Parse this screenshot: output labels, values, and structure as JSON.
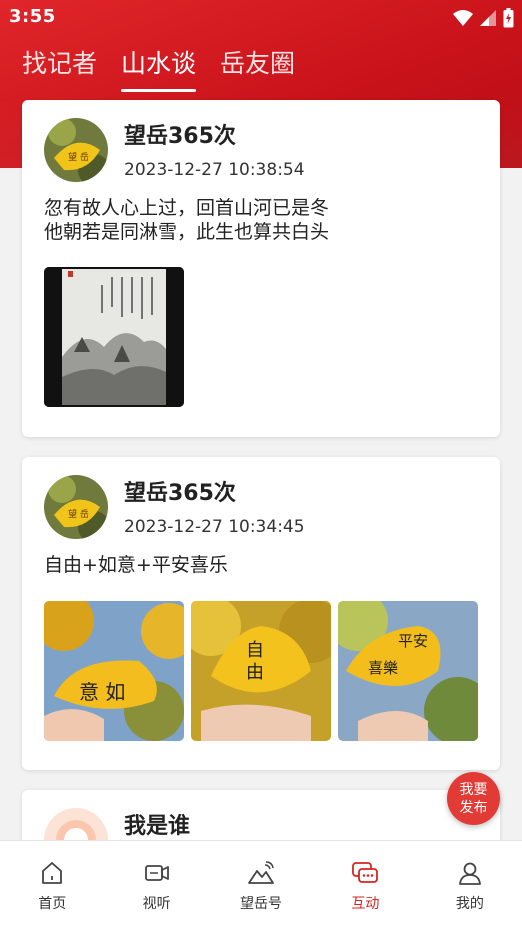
{
  "status_bar": {
    "time": "3:55"
  },
  "tabs": [
    {
      "label": "找记者",
      "active": false
    },
    {
      "label": "山水谈",
      "active": true
    },
    {
      "label": "岳友圈",
      "active": false
    }
  ],
  "posts": [
    {
      "user": "望岳365次",
      "time": "2023-12-27 10:38:54",
      "text": "忽有故人心上过，回首山河已是冬\n他朝若是同淋雪，此生也算共白头",
      "images": [
        "snow-landscape-calligraphy"
      ]
    },
    {
      "user": "望岳365次",
      "time": "2023-12-27 10:34:45",
      "text": "自由+如意+平安喜乐",
      "images": [
        "ginkgo-leaf-ruyi",
        "ginkgo-leaf-ziyou",
        "ginkgo-leaf-pingan-xile"
      ]
    },
    {
      "user": "我是谁"
    }
  ],
  "fab": {
    "line1": "我要",
    "line2": "发布"
  },
  "bottom_nav": [
    {
      "label": "首页",
      "icon": "home-icon",
      "active": false
    },
    {
      "label": "视听",
      "icon": "video-icon",
      "active": false
    },
    {
      "label": "望岳号",
      "icon": "mountain-icon",
      "active": false
    },
    {
      "label": "互动",
      "icon": "chat-icon",
      "active": true
    },
    {
      "label": "我的",
      "icon": "user-icon",
      "active": false
    }
  ],
  "colors": {
    "brand_red": "#d7241f",
    "header_red": "#e0262a"
  }
}
